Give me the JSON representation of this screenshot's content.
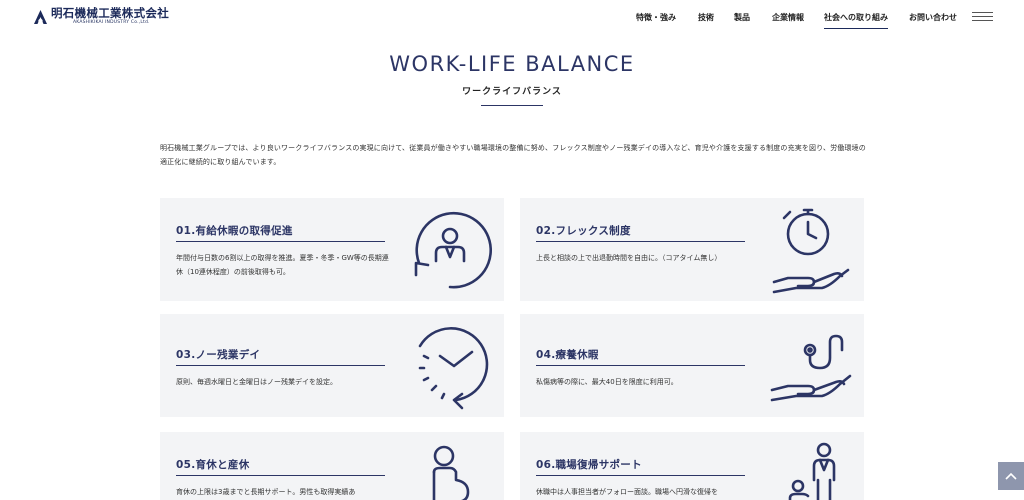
{
  "header": {
    "logo_jp": "明石機械工業株式会社",
    "logo_en": "AKASHIKIKAI INDUSTRY Co.,Ltd.",
    "nav": [
      {
        "label": "特徴・強み"
      },
      {
        "label": "技術"
      },
      {
        "label": "製品"
      },
      {
        "label": "企業情報"
      },
      {
        "label": "社会への取り組み",
        "active": true
      },
      {
        "label": "お問い合わせ"
      }
    ]
  },
  "page": {
    "title_en": "WORK-LIFE BALANCE",
    "title_jp": "ワークライフバランス",
    "intro": "明石機械工業グループでは、より良いワークライフバランスの実現に向けて、従業員が働きやすい職場環境の整備に努め、フレックス制度やノー残業デイの導入など、育児や介護を支援する制度の充実を図り、労働環境の適正化に継続的に取り組んでいます。"
  },
  "cards": [
    {
      "title": "01.有給休暇の取得促進",
      "desc": "年間付与日数の6割以上の取得を推進。夏季・冬季・GW等の長期連休（10連休程度）の前後取得も可。",
      "icon": "person-cycle-icon"
    },
    {
      "title": "02.フレックス制度",
      "desc": "上長と相談の上で出退勤時間を自由に。（コアタイム無し）",
      "icon": "stopwatch-hand-icon"
    },
    {
      "title": "03.ノー残業デイ",
      "desc": "原則、毎週水曜日と金曜日はノー残業デイを設定。",
      "icon": "clock-arrow-icon"
    },
    {
      "title": "04.療養休暇",
      "desc": "私傷病等の際に、最大40日を限度に利用可。",
      "icon": "stethoscope-hand-icon"
    },
    {
      "title": "05.育休と産休",
      "desc": "育休の上限は3歳までと長期サポート。男性も取得実績あ",
      "icon": "pregnant-woman-icon"
    },
    {
      "title": "06.職場復帰サポート",
      "desc": "休職中は人事担当者がフォロー面談。職場へ円滑な復帰を",
      "icon": "parent-child-icon"
    }
  ],
  "colors": {
    "navy": "#2c3565",
    "card_bg": "#f3f4f6",
    "pagetop": "#8e96ad"
  }
}
